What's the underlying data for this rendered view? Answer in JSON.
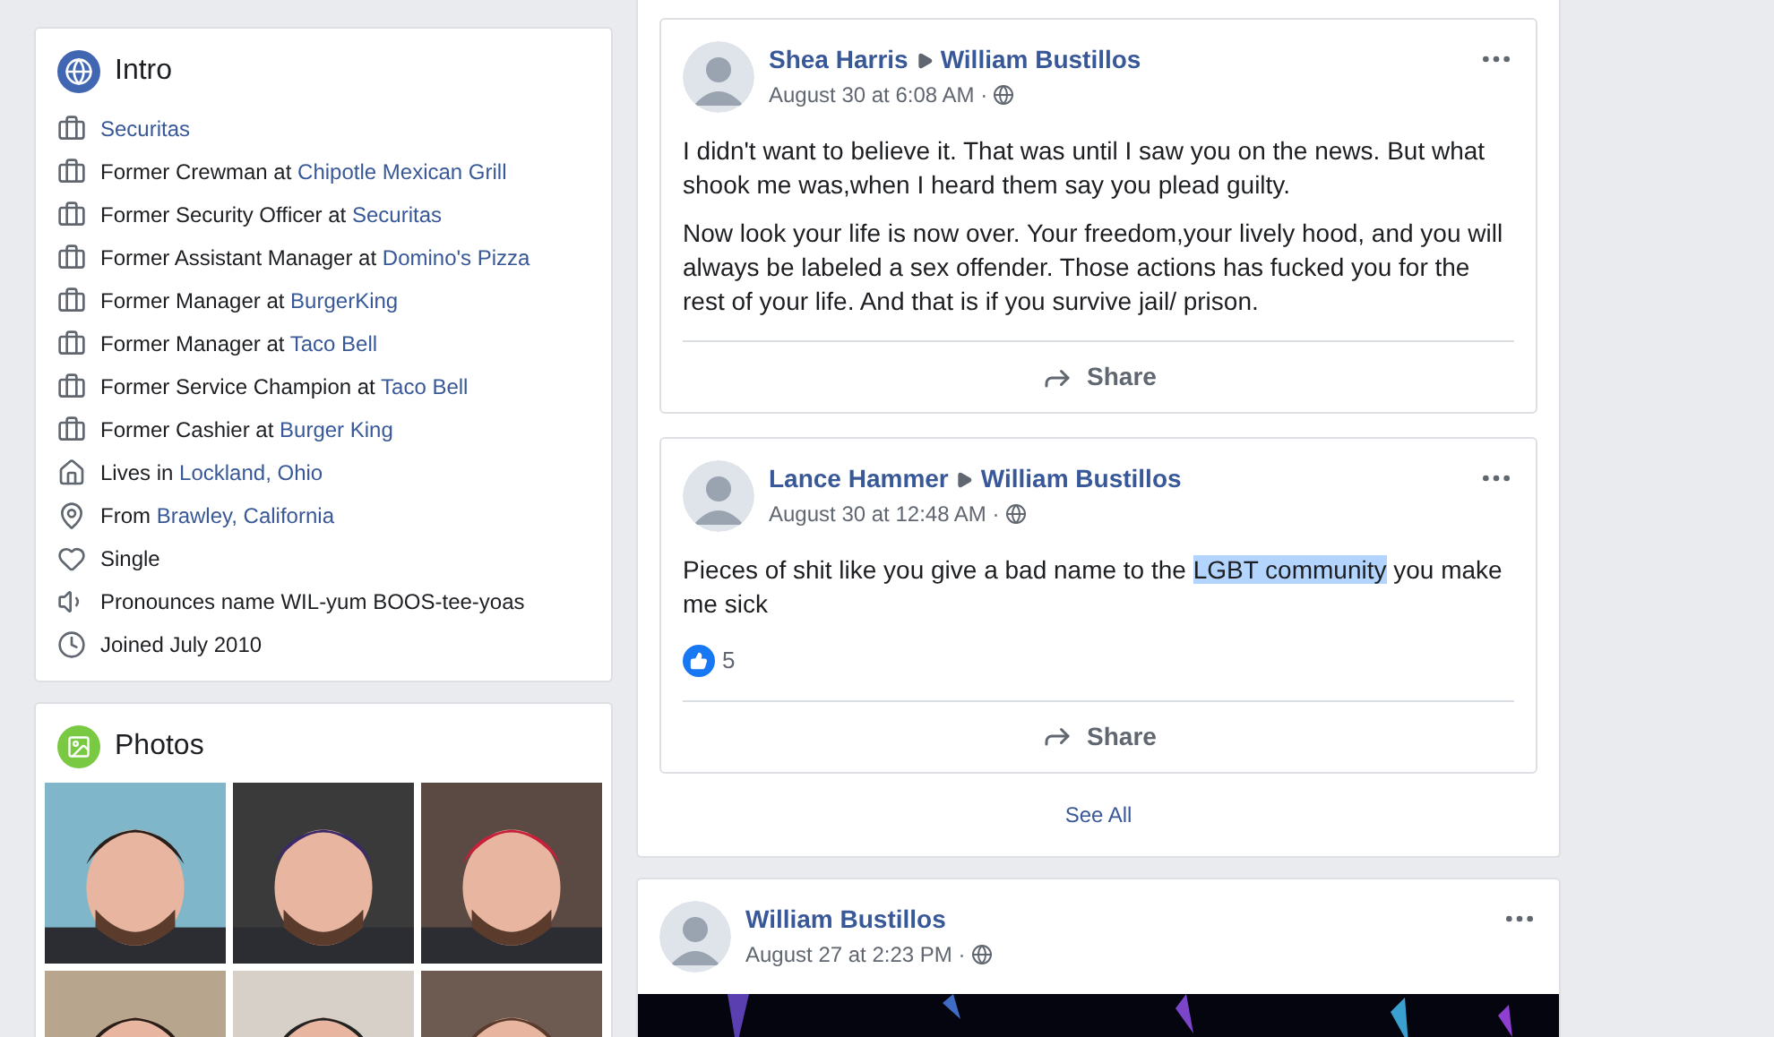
{
  "intro": {
    "title": "Intro",
    "items": [
      {
        "kind": "work",
        "link": "Securitas"
      },
      {
        "kind": "work",
        "prefix": "Former Crewman at ",
        "link": "Chipotle Mexican Grill"
      },
      {
        "kind": "work",
        "prefix": "Former Security Officer at ",
        "link": "Securitas"
      },
      {
        "kind": "work",
        "prefix": "Former Assistant Manager at ",
        "link": "Domino's Pizza"
      },
      {
        "kind": "work",
        "prefix": "Former Manager at ",
        "link": "BurgerKing"
      },
      {
        "kind": "work",
        "prefix": "Former Manager at ",
        "link": "Taco Bell"
      },
      {
        "kind": "work",
        "prefix": "Former Service Champion at ",
        "link": "Taco Bell"
      },
      {
        "kind": "work",
        "prefix": "Former Cashier at ",
        "link": "Burger King"
      },
      {
        "kind": "home",
        "prefix": "Lives in ",
        "link": "Lockland, Ohio"
      },
      {
        "kind": "pin",
        "prefix": "From ",
        "link": "Brawley, California"
      },
      {
        "kind": "heart",
        "prefix": "Single"
      },
      {
        "kind": "speaker",
        "prefix": "Pronounces name WIL-yum BOOS-tee-yoas"
      },
      {
        "kind": "clock",
        "prefix": "Joined July 2010"
      }
    ]
  },
  "photos": {
    "title": "Photos"
  },
  "comments": [
    {
      "author": "Shea Harris",
      "target": "William Bustillos",
      "time": "August 30 at 6:08 AM · ",
      "paragraphs": [
        [
          {
            "text": "I didn't want to believe it. That was until I saw you on the news. But what shook me was,when I heard them say you plead guilty.",
            "highlighted": false
          }
        ],
        [
          {
            "text": "Now look your life is now over. Your freedom,your lively hood, and you will always be labeled a sex offender. Those actions has fucked you for the rest of your life. And that is if you survive jail/ prison.",
            "highlighted": false
          }
        ]
      ],
      "share": "Share"
    },
    {
      "author": "Lance Hammer",
      "target": "William Bustillos",
      "time": "August 30 at 12:48 AM · ",
      "paragraphs": [
        [
          {
            "text": "Pieces of shit like you give a bad name to the ",
            "highlighted": false
          },
          {
            "text": "LGBT community",
            "highlighted": true
          },
          {
            "text": " you make me sick",
            "highlighted": false
          }
        ]
      ],
      "likes": "5",
      "share": "Share"
    }
  ],
  "see_all": "See All",
  "post": {
    "author": "William Bustillos",
    "time": "August 27 at 2:23 PM · "
  }
}
